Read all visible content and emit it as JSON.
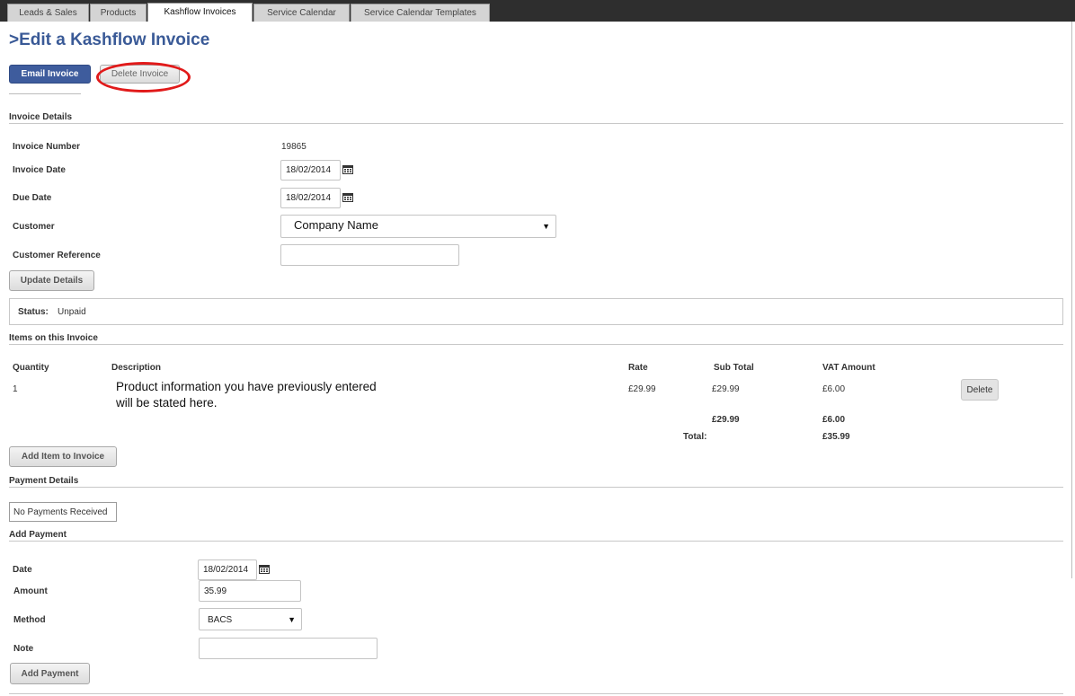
{
  "tabs": [
    {
      "label": "Leads & Sales",
      "active": false
    },
    {
      "label": "Products",
      "active": false
    },
    {
      "label": "Kashflow Invoices",
      "active": true
    },
    {
      "label": "Service Calendar",
      "active": false
    },
    {
      "label": "Service Calendar Templates",
      "active": false
    }
  ],
  "page_title": ">Edit a Kashflow Invoice",
  "actions": {
    "email_label": "Email Invoice",
    "delete_label": "Delete Invoice"
  },
  "invoice_details": {
    "section_title": "Invoice Details",
    "invoice_number_label": "Invoice Number",
    "invoice_number": "19865",
    "invoice_date_label": "Invoice Date",
    "invoice_date": "18/02/2014",
    "due_date_label": "Due Date",
    "due_date": "18/02/2014",
    "customer_label": "Customer",
    "customer_value": "Company Name",
    "customer_reference_label": "Customer Reference",
    "customer_reference": "",
    "update_label": "Update Details"
  },
  "status": {
    "label": "Status:",
    "value": "Unpaid"
  },
  "items": {
    "section_title": "Items on this Invoice",
    "columns": {
      "quantity": "Quantity",
      "description": "Description",
      "rate": "Rate",
      "subtotal": "Sub Total",
      "vat": "VAT Amount"
    },
    "rows": [
      {
        "quantity": "1",
        "description": "Product information you have previously entered will be stated here.",
        "rate": "£29.99",
        "subtotal": "£29.99",
        "vat": "£6.00",
        "delete_label": "Delete"
      }
    ],
    "totals": {
      "subtotal": "£29.99",
      "vat": "£6.00",
      "total_label": "Total:",
      "total": "£35.99"
    },
    "add_label": "Add Item to Invoice"
  },
  "payment_details": {
    "section_title": "Payment Details",
    "empty_text": "No Payments Received"
  },
  "add_payment": {
    "section_title": "Add Payment",
    "date_label": "Date",
    "date": "18/02/2014",
    "amount_label": "Amount",
    "amount": "35.99",
    "method_label": "Method",
    "method": "BACS",
    "note_label": "Note",
    "note": "",
    "submit_label": "Add Payment"
  },
  "colors": {
    "accent": "#3e5c9d",
    "title": "#3a5a97",
    "highlight_ring": "#e11a1a",
    "tabbar": "#2e2e2e"
  }
}
